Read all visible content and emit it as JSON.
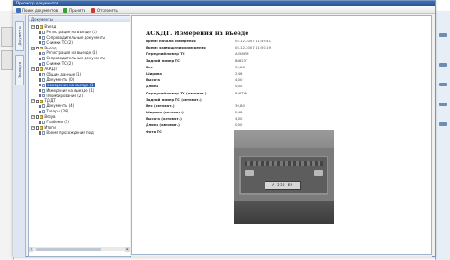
{
  "window": {
    "title": "Просмотр документов"
  },
  "toolbar": {
    "buttons": [
      {
        "label": "Поиск документов",
        "icon": "search-icon",
        "color": "#3a6fc0"
      },
      {
        "label": "Принять",
        "icon": "accept-icon",
        "color": "#3a9a3a"
      },
      {
        "label": "Отклонить",
        "icon": "reject-icon",
        "color": "#c43a3a"
      }
    ]
  },
  "side_tabs": [
    {
      "label": "Документы"
    },
    {
      "label": "Закладки"
    }
  ],
  "nav": {
    "header": "Документы",
    "items": [
      {
        "label": "Въезд",
        "level": 0,
        "kind": "folder",
        "expander": "−"
      },
      {
        "label": "Регистрация на въезде (1)",
        "level": 1,
        "kind": "doc"
      },
      {
        "label": "Сопроводительные документы",
        "level": 1,
        "kind": "doc"
      },
      {
        "label": "Снимки ТС (2)",
        "level": 1,
        "kind": "doc"
      },
      {
        "label": "Выезд",
        "level": 0,
        "kind": "folder",
        "expander": "−"
      },
      {
        "label": "Регистрация на выезде (1)",
        "level": 1,
        "kind": "doc"
      },
      {
        "label": "Сопроводительные документы",
        "level": 1,
        "kind": "doc"
      },
      {
        "label": "Снимки ТС (2)",
        "level": 1,
        "kind": "doc"
      },
      {
        "label": "АСКДТ",
        "level": 0,
        "kind": "folder",
        "expander": "−"
      },
      {
        "label": "Общие данные (1)",
        "level": 1,
        "kind": "doc"
      },
      {
        "label": "Документы (0)",
        "level": 1,
        "kind": "doc"
      },
      {
        "label": "Измерения на въезде (1)",
        "level": 1,
        "kind": "doc",
        "selected": true
      },
      {
        "label": "Измерения на выезде (1)",
        "level": 1,
        "kind": "doc"
      },
      {
        "label": "Пломбирование (2)",
        "level": 1,
        "kind": "doc"
      },
      {
        "label": "ТД/ДТ",
        "level": 0,
        "kind": "folder",
        "expander": "−"
      },
      {
        "label": "Документы (4)",
        "level": 1,
        "kind": "doc"
      },
      {
        "label": "Товары (28)",
        "level": 1,
        "kind": "doc"
      },
      {
        "label": "Везув",
        "level": 0,
        "kind": "folder",
        "expander": "−"
      },
      {
        "label": "Грабежи (1)",
        "level": 1,
        "kind": "doc"
      },
      {
        "label": "Итоги",
        "level": 0,
        "kind": "folder",
        "expander": "−"
      },
      {
        "label": "Время прохождения под",
        "level": 1,
        "kind": "doc"
      }
    ]
  },
  "document": {
    "title": "АСКДТ. Измерения на въезде",
    "fields": [
      {
        "label": "Время начала измерения",
        "value": "05.12.2007 11:49:41"
      },
      {
        "label": "Время завершения измерения",
        "value": "05.12.2007 11:50:19"
      },
      {
        "label": "Передний номер ТС",
        "value": "A556EM"
      },
      {
        "label": "Задний номер ТС",
        "value": "886237"
      },
      {
        "label": "Вес",
        "value": "39,86"
      },
      {
        "label": "Ширина",
        "value": "2,46"
      },
      {
        "label": "Высота",
        "value": "4,00"
      },
      {
        "label": "Длина",
        "value": "0,00"
      },
      {
        "label": "Передний номер ТС (автомат.)",
        "value": "836TW"
      },
      {
        "label": "Задний номер ТС (автомат.)",
        "value": ""
      },
      {
        "label": "Вес (автомат.)",
        "value": "39,80"
      },
      {
        "label": "Ширина (автомат.)",
        "value": "2,48"
      },
      {
        "label": "Высота (автомат.)",
        "value": "4,00"
      },
      {
        "label": "Длина (автомат.)",
        "value": "0,00"
      },
      {
        "label": "Фото ТС",
        "value": ""
      }
    ],
    "photo_plate": "A 556 EM"
  },
  "colors": {
    "titlebar": "#2a5597",
    "selection": "#2f5fae",
    "panel_border": "#9fb3cc"
  }
}
